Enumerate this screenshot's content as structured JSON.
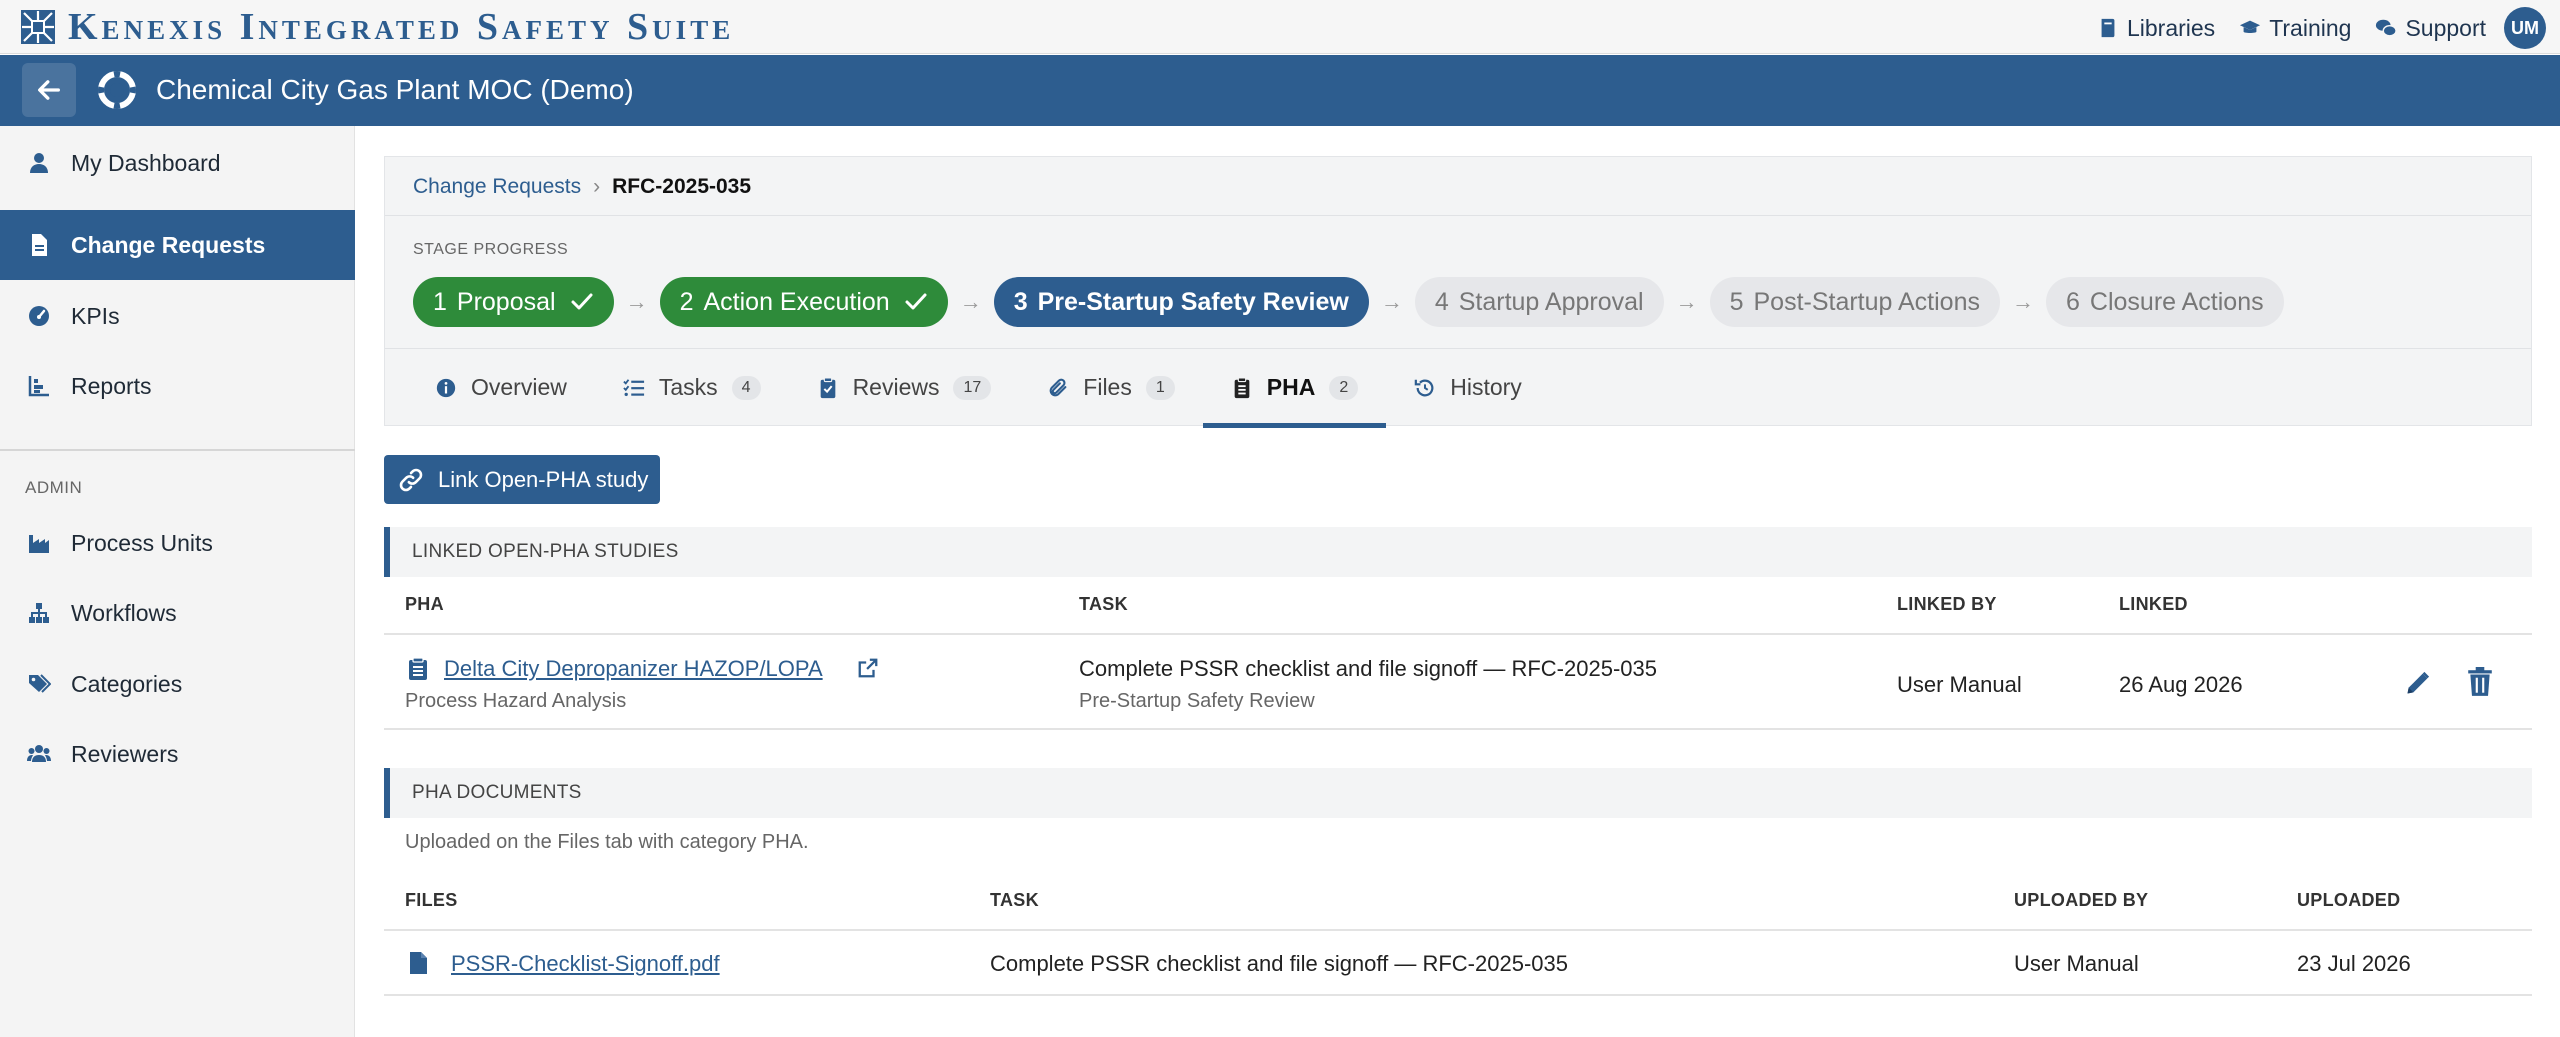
{
  "app": {
    "brand": "Kenexis Integrated Safety Suite",
    "top_links": [
      {
        "label": "Libraries",
        "icon": "book-icon"
      },
      {
        "label": "Training",
        "icon": "graduation-cap-icon"
      },
      {
        "label": "Support",
        "icon": "comments-icon"
      }
    ],
    "user_initials": "UM",
    "title": "Chemical City Gas Plant MOC (Demo)"
  },
  "sidebar": {
    "items": [
      {
        "label": "My Dashboard",
        "icon": "user-icon"
      },
      {
        "label": "Change Requests",
        "icon": "file-icon",
        "active": true
      },
      {
        "label": "KPIs",
        "icon": "gauge-icon"
      },
      {
        "label": "Reports",
        "icon": "bar-chart-icon"
      }
    ],
    "admin_label": "ADMIN",
    "admin_items": [
      {
        "label": "Process Units",
        "icon": "industry-icon"
      },
      {
        "label": "Workflows",
        "icon": "sitemap-icon"
      },
      {
        "label": "Categories",
        "icon": "tags-icon"
      },
      {
        "label": "Reviewers",
        "icon": "users-icon"
      }
    ]
  },
  "breadcrumb": {
    "parent": "Change Requests",
    "separator": "›",
    "current": "RFC-2025-035"
  },
  "stage_progress": {
    "label": "STAGE PROGRESS",
    "stages": [
      {
        "num": "1",
        "name": "Proposal",
        "status": "done"
      },
      {
        "num": "2",
        "name": "Action Execution",
        "status": "done"
      },
      {
        "num": "3",
        "name": "Pre-Startup Safety Review",
        "status": "current"
      },
      {
        "num": "4",
        "name": "Startup Approval",
        "status": "pending"
      },
      {
        "num": "5",
        "name": "Post-Startup Actions",
        "status": "pending"
      },
      {
        "num": "6",
        "name": "Closure Actions",
        "status": "pending"
      }
    ],
    "arrow": "→"
  },
  "tabs": [
    {
      "label": "Overview",
      "count": null
    },
    {
      "label": "Tasks",
      "count": "4"
    },
    {
      "label": "Reviews",
      "count": "17"
    },
    {
      "label": "Files",
      "count": "1"
    },
    {
      "label": "PHA",
      "count": "2",
      "active": true
    },
    {
      "label": "History",
      "count": null
    }
  ],
  "link_button": "Link Open-PHA study",
  "linked_studies": {
    "title": "LINKED OPEN-PHA STUDIES",
    "columns": [
      "PHA",
      "TASK",
      "LINKED BY",
      "LINKED"
    ],
    "rows": [
      {
        "pha": "Delta City Depropanizer HAZOP/LOPA",
        "pha_type": "Process Hazard Analysis",
        "task": "Complete PSSR checklist and file signoff — RFC-2025-035",
        "task_stage": "Pre-Startup Safety Review",
        "linked_by": "User Manual",
        "linked": "26 Aug 2026"
      }
    ]
  },
  "pha_documents": {
    "title": "PHA DOCUMENTS",
    "note": "Uploaded on the Files tab with category PHA.",
    "columns": [
      "FILES",
      "TASK",
      "UPLOADED BY",
      "UPLOADED"
    ],
    "rows": [
      {
        "file": "PSSR-Checklist-Signoff.pdf",
        "task": "Complete PSSR checklist and file signoff — RFC-2025-035",
        "uploaded_by": "User Manual",
        "uploaded": "23 Jul 2026"
      }
    ]
  },
  "colors": {
    "primary": "#2d5d8f",
    "done": "#2e8b3a",
    "pending": "#e6e7ea"
  }
}
